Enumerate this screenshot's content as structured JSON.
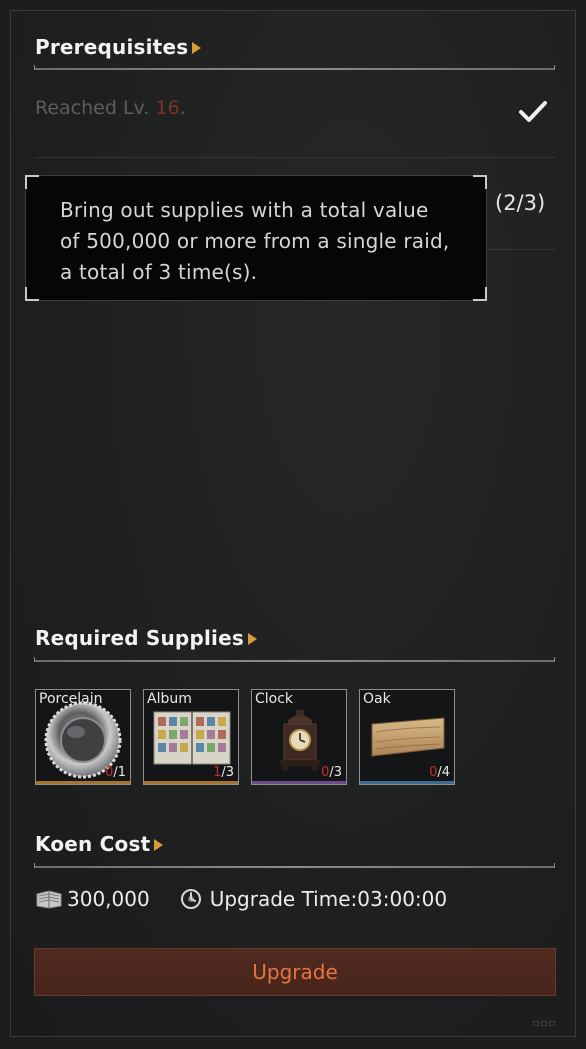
{
  "prerequisites": {
    "title": "Prerequisites",
    "level_req_prefix": "Reached Lv. ",
    "level_value": "16",
    "level_req_suffix": ".",
    "task_progress": "(2/3)"
  },
  "tooltip": {
    "text": "Bring out supplies with a total value of 500,000 or more from a single raid, a total of 3 time(s)."
  },
  "supplies": {
    "title": "Required Supplies",
    "items": [
      {
        "name": "Porcelain",
        "have": "0",
        "need": "/1",
        "rarity_color": "#a5742f",
        "icon": "silver-plate-icon"
      },
      {
        "name": "Album",
        "have": "1",
        "need": "/3",
        "rarity_color": "#a5742f",
        "icon": "stamp-album-icon"
      },
      {
        "name": "Clock",
        "have": "0",
        "need": "/3",
        "rarity_color": "#6a4a8a",
        "icon": "antique-clock-icon"
      },
      {
        "name": "Oak",
        "have": "0",
        "need": "/4",
        "rarity_color": "#3d6a92",
        "icon": "oak-plank-icon"
      }
    ]
  },
  "cost": {
    "title": "Koen Cost",
    "amount": "300,000",
    "upgrade_time_label": "Upgrade Time:",
    "upgrade_time_value": "03:00:00"
  },
  "actions": {
    "upgrade_label": "Upgrade"
  },
  "colors": {
    "accent": "#d79a3c",
    "upgrade_text": "#e4753e",
    "upgrade_bg": "#50291f",
    "missing_count": "#c2302a"
  }
}
